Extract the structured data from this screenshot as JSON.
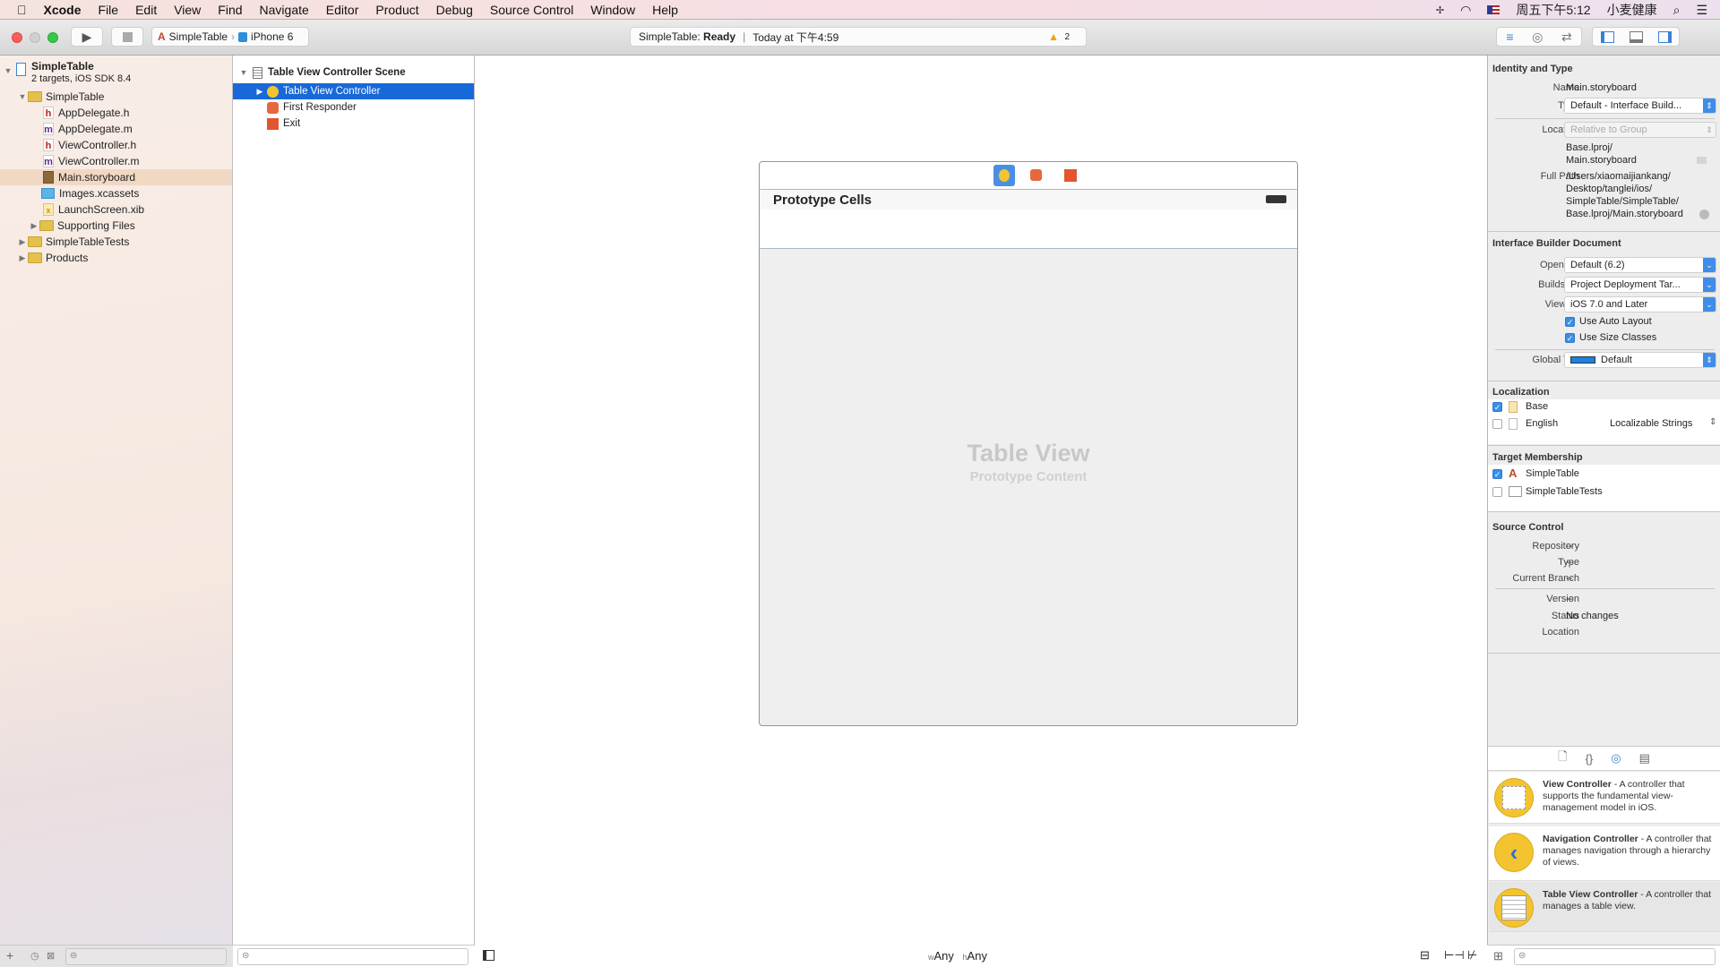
{
  "menubar": {
    "app": "Xcode",
    "items": [
      "File",
      "Edit",
      "View",
      "Find",
      "Navigate",
      "Editor",
      "Product",
      "Debug",
      "Source Control",
      "Window",
      "Help"
    ],
    "clock": "周五下午5:12",
    "user": "小麦健康"
  },
  "toolbar": {
    "scheme": "SimpleTable",
    "device": "iPhone 6",
    "status_project": "SimpleTable:",
    "status_state": "Ready",
    "status_time": "Today at 下午4:59",
    "warnings": "2"
  },
  "navigator": {
    "project": {
      "name": "SimpleTable",
      "subtitle": "2 targets, iOS SDK 8.4"
    },
    "items": [
      {
        "label": "SimpleTable",
        "type": "folder"
      },
      {
        "label": "AppDelegate.h",
        "type": "h"
      },
      {
        "label": "AppDelegate.m",
        "type": "m"
      },
      {
        "label": "ViewController.h",
        "type": "h"
      },
      {
        "label": "ViewController.m",
        "type": "m"
      },
      {
        "label": "Main.storyboard",
        "type": "storyboard",
        "selected": true
      },
      {
        "label": "Images.xcassets",
        "type": "xcassets"
      },
      {
        "label": "LaunchScreen.xib",
        "type": "xib"
      },
      {
        "label": "Supporting Files",
        "type": "folder"
      },
      {
        "label": "SimpleTableTests",
        "type": "folder"
      },
      {
        "label": "Products",
        "type": "folder"
      }
    ]
  },
  "outline": {
    "scene": "Table View Controller Scene",
    "items": [
      "Table View Controller",
      "First Responder",
      "Exit"
    ]
  },
  "canvas": {
    "header": "Prototype Cells",
    "placeholder_title": "Table View",
    "placeholder_sub": "Prototype Content",
    "size_w": "Any",
    "size_h": "Any",
    "w_prefix": "w",
    "h_prefix": "h"
  },
  "inspector": {
    "identity": {
      "title": "Identity and Type",
      "name_label": "Name",
      "name": "Main.storyboard",
      "type_label": "Type",
      "type": "Default - Interface Build...",
      "location_label": "Location",
      "location": "Relative to Group",
      "rel_path1": "Base.lproj/",
      "rel_path2": "Main.storyboard",
      "full_path_label": "Full Path",
      "full_path": [
        "/Users/xiaomaijiankang/",
        "Desktop/tanglei/ios/",
        "SimpleTable/SimpleTable/",
        "Base.lproj/Main.storyboard"
      ]
    },
    "ib": {
      "title": "Interface Builder Document",
      "opens_label": "Opens in",
      "opens": "Default (6.2)",
      "builds_label": "Builds for",
      "builds": "Project Deployment Tar...",
      "viewas_label": "View as",
      "viewas": "iOS 7.0 and Later",
      "autolayout": "Use Auto Layout",
      "sizeclasses": "Use Size Classes",
      "tint_label": "Global Tint",
      "tint": "Default",
      "tint_color": "#1a82e2"
    },
    "localization": {
      "title": "Localization",
      "base": "Base",
      "english": "English",
      "english_type": "Localizable Strings"
    },
    "membership": {
      "title": "Target Membership",
      "t1": "SimpleTable",
      "t2": "SimpleTableTests"
    },
    "source": {
      "title": "Source Control",
      "repo_label": "Repository",
      "repo": "--",
      "type_label": "Type",
      "type": "--",
      "branch_label": "Current Branch",
      "branch": "--",
      "version_label": "Version",
      "version": "--",
      "status_label": "Status",
      "status": "No changes",
      "location_label": "Location"
    }
  },
  "library": [
    {
      "name": "View Controller",
      "desc": " - A controller that supports the fundamental view-management model in iOS."
    },
    {
      "name": "Navigation Controller",
      "desc": " - A controller that manages navigation through a hierarchy of views."
    },
    {
      "name": "Table View Controller",
      "desc": " - A controller that manages a table view."
    }
  ],
  "colors": {
    "selection": "#1869d8",
    "accent": "#3b8ee6"
  }
}
